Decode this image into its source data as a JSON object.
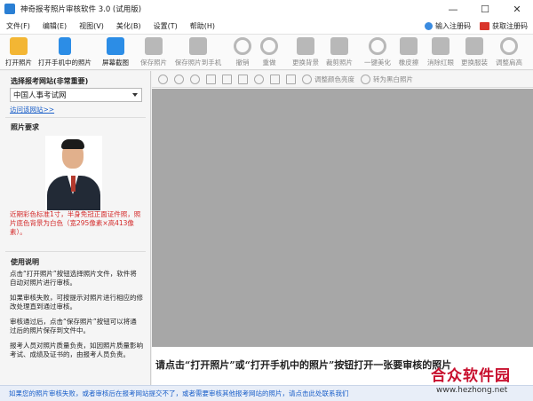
{
  "window": {
    "title": "神奇报考照片审核软件 3.0 (试用版)",
    "minimize": "—",
    "maximize": "☐",
    "close": "✕"
  },
  "menu": {
    "items": [
      "文件(F)",
      "编辑(E)",
      "视图(V)",
      "美化(B)",
      "设置(T)",
      "帮助(H)"
    ],
    "register_code": "输入注册码",
    "get_code": "获取注册码"
  },
  "toolbar": {
    "items": [
      {
        "label": "打开照片",
        "icon": "folder-open-icon"
      },
      {
        "label": "打开手机中的照片",
        "icon": "phone-icon"
      },
      {
        "label": "屏幕截图",
        "icon": "camera-icon"
      },
      {
        "label": "保存照片",
        "icon": "save-icon"
      },
      {
        "label": "保存照片到手机",
        "icon": "save-phone-icon"
      },
      {
        "label": "撤销",
        "icon": "undo-icon"
      },
      {
        "label": "重做",
        "icon": "redo-icon"
      },
      {
        "label": "更换背景",
        "icon": "background-icon"
      },
      {
        "label": "裁剪照片",
        "icon": "crop-icon"
      },
      {
        "label": "一键美化",
        "icon": "beautify-icon"
      },
      {
        "label": "橡皮擦",
        "icon": "eraser-icon"
      },
      {
        "label": "消除红眼",
        "icon": "red-eye-icon"
      },
      {
        "label": "更换服装",
        "icon": "clothes-icon"
      },
      {
        "label": "调整肩高",
        "icon": "shoulder-icon"
      }
    ]
  },
  "edit_bar": {
    "adjust_color": "调整颜色亮度",
    "to_bw": "转为黑白照片"
  },
  "left": {
    "site_title": "选择报考网站(非常重要)",
    "site_value": "中国人事考试网",
    "visit_link": "访问该网站>>",
    "photo_title": "照片要求",
    "requirement": "近期彩色标准1寸，半身免冠正面证件照，照片底色背景为白色（宽295像素×高413像素）。",
    "usage_title": "使用说明",
    "instructions": [
      "点击“打开照片”按钮选择照片文件，软件将自动对照片进行审核。",
      "如果审核失败，可按提示对照片进行相应的修改处理直到通过审核。",
      "审核通过后，点击“保存照片”按钮可以将通过后的照片保存到文件中。",
      "报考人员对照片质量负责，如因照片质量影响考试、成绩及证书的，由报考人员负责。"
    ]
  },
  "canvas": {
    "hint": "请点击“打开照片”或“打开手机中的照片”按钮打开一张要审核的照片"
  },
  "status": {
    "text": "如果您的照片审核失败，或者审核后在报考网站提交不了，或者需要审核其他报考网站的照片，请点击此处联系我们"
  },
  "watermark": {
    "logo": "合众软件园",
    "url": "www.hezhong.net"
  }
}
